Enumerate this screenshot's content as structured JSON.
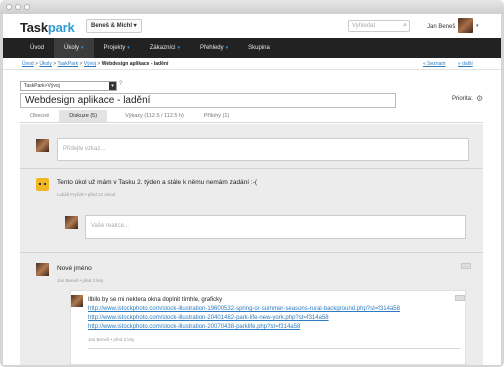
{
  "header": {
    "logo_main": "Task",
    "logo_accent": "park",
    "org_selector": "Beneš & Michl ▾",
    "search_placeholder": "Vyhledat",
    "user_name": "Jan Beneš",
    "user_caret": "▾"
  },
  "nav": {
    "items": [
      {
        "label": "Úvod",
        "caret": ""
      },
      {
        "label": "Úkoly",
        "caret": "▾"
      },
      {
        "label": "Projekty",
        "caret": "▾"
      },
      {
        "label": "Zákazníci",
        "caret": "▾"
      },
      {
        "label": "Přehledy",
        "caret": "▾"
      },
      {
        "label": "Skupina",
        "caret": ""
      }
    ]
  },
  "breadcrumb": {
    "items": [
      "Úvod",
      "Úkoly",
      "TaskPark",
      "Vývoj"
    ],
    "current": "Webdesign aplikace - ladění",
    "sep": ">",
    "prev": "« Seznam",
    "next": "» další"
  },
  "task": {
    "context": "TaskPark>Vývoj",
    "context_help": "?",
    "title": "Webdesign aplikace - ladění",
    "priority_label": "Priorita:"
  },
  "tabs": [
    {
      "label": "Obecné"
    },
    {
      "label": "Diskuze (5)"
    },
    {
      "label": "Výkazy (112.5 / 112.5 h)"
    },
    {
      "label": "Přílohy (1)"
    }
  ],
  "discussion": {
    "new_comment_placeholder": "Přidejte vzkaz...",
    "comments": [
      {
        "text": "Tento úkol už mám v Tasku 2. týden a stále k němu nemám zadání :-(",
        "meta": "Lukáš Fryček • před 12 minut"
      },
      {
        "text": "Nové jméno",
        "meta": "Jan Beneš • před 2 lety"
      }
    ],
    "reply_placeholder": "Vaše reakce...",
    "reply": {
      "text": "Ilbilo by se mi nektera okna doplnit tímhle, graficky",
      "links": [
        "http://www.istockphoto.com/stock-illustration-19600532-spring-or-summer-seasons-rural-background.php?st=f314a58",
        "http://www.istockphoto.com/stock-illustration-20401482-park-life-new-york.php?st=f314a58",
        "http://www.istockphoto.com/stock-illustration-20070438-parklife.php?st=f314a58"
      ],
      "meta": "Jan Beneš • před 2 lety"
    }
  }
}
